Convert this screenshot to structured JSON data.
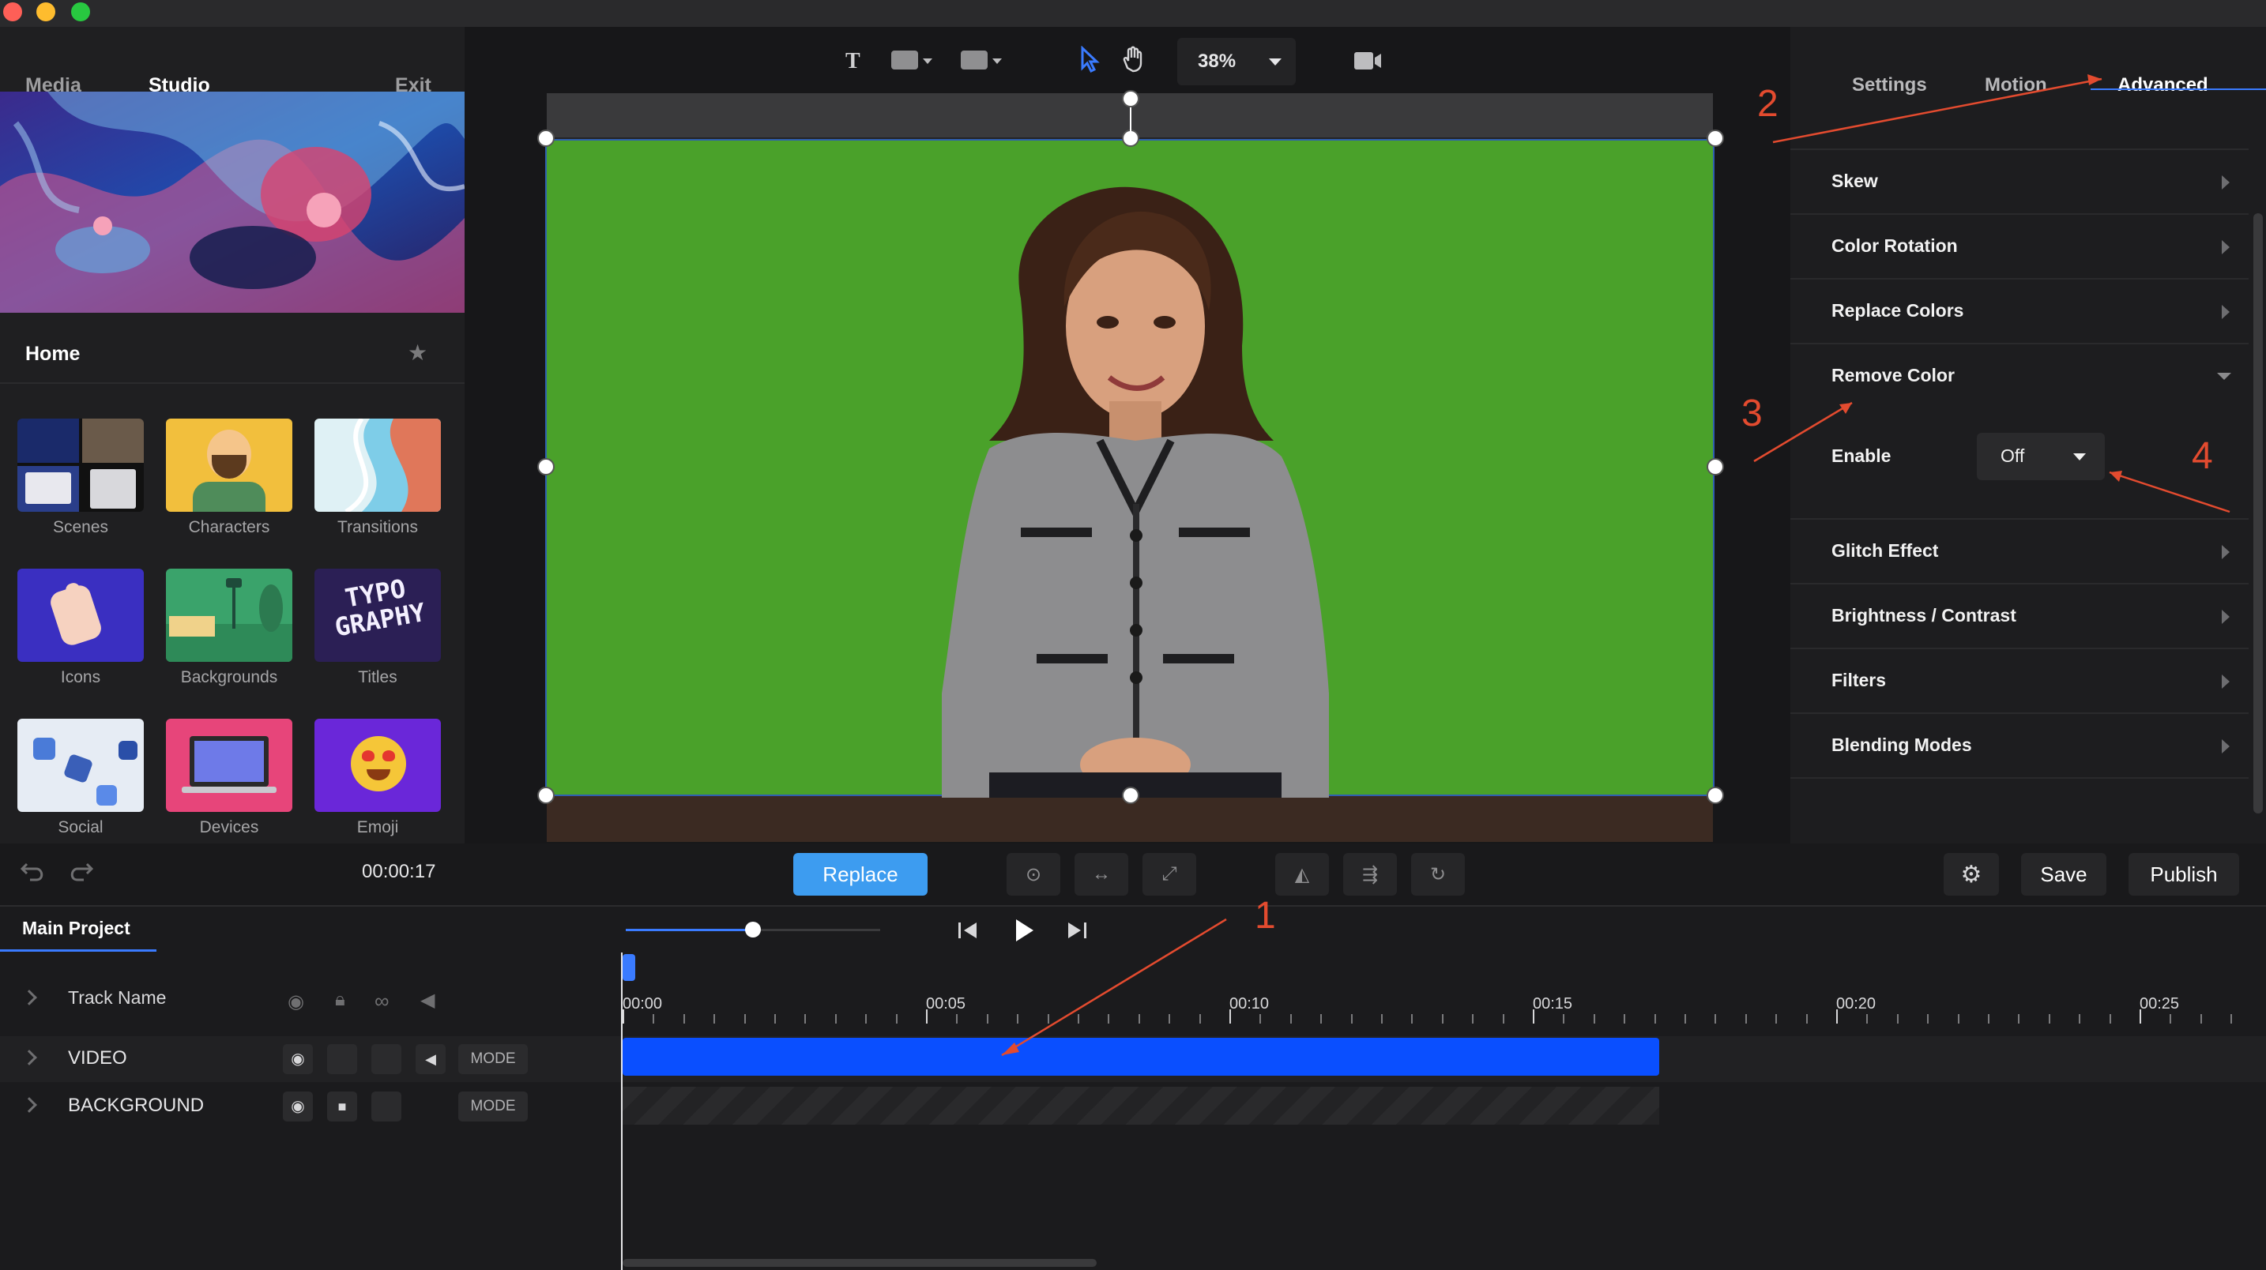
{
  "left_nav": {
    "media": "Media",
    "studio": "Studio",
    "exit": "Exit"
  },
  "home": {
    "title": "Home"
  },
  "categories": [
    {
      "label": "Scenes"
    },
    {
      "label": "Characters"
    },
    {
      "label": "Transitions"
    },
    {
      "label": "Icons"
    },
    {
      "label": "Backgrounds"
    },
    {
      "label": "Titles"
    },
    {
      "label": "Social"
    },
    {
      "label": "Devices"
    },
    {
      "label": "Emoji"
    }
  ],
  "titles_thumb_text": "TYPO GRAPHY",
  "timecode": "00:00:17",
  "toolbar": {
    "zoom": "38%",
    "replace": "Replace",
    "save": "Save",
    "publish": "Publish"
  },
  "right_tabs": {
    "settings": "Settings",
    "motion": "Motion",
    "advanced": "Advanced"
  },
  "properties": [
    {
      "label": "Skew"
    },
    {
      "label": "Color Rotation"
    },
    {
      "label": "Replace Colors"
    },
    {
      "label": "Remove Color"
    },
    {
      "label": "Glitch Effect"
    },
    {
      "label": "Brightness / Contrast"
    },
    {
      "label": "Filters"
    },
    {
      "label": "Blending Modes"
    }
  ],
  "remove_color": {
    "enable_label": "Enable",
    "enable_value": "Off"
  },
  "project_tab": "Main Project",
  "tracks": {
    "header": "Track Name",
    "rows": [
      {
        "name": "VIDEO",
        "mode": "MODE"
      },
      {
        "name": "BACKGROUND",
        "mode": "MODE"
      }
    ]
  },
  "ruler": [
    "00:00",
    "00:05",
    "00:10",
    "00:15",
    "00:20",
    "00:25"
  ],
  "playback_progress": 0.5,
  "annotations": [
    "1",
    "2",
    "3",
    "4"
  ],
  "colors": {
    "accent_blue": "#0a4fff",
    "replace_blue": "#3d9cf0",
    "greenscreen": "#4aa12a",
    "annotation_red": "#e34b2f"
  }
}
